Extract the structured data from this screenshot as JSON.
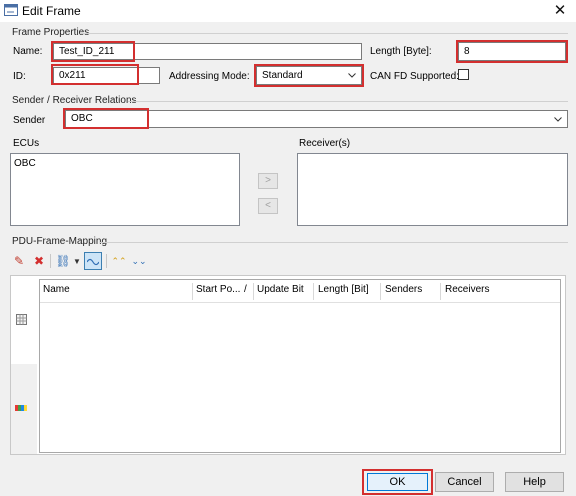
{
  "window": {
    "title": "Edit Frame"
  },
  "frame_properties": {
    "group_title": "Frame Properties",
    "name_label": "Name:",
    "name_value": "Test_ID_211",
    "length_label": "Length [Byte]:",
    "length_value": "8",
    "id_label": "ID:",
    "id_value": "0x211",
    "addressing_label": "Addressing Mode:",
    "addressing_value": "Standard",
    "canfd_label": "CAN FD Supported:"
  },
  "sender_receiver": {
    "group_title": "Sender / Receiver Relations",
    "sender_label": "Sender",
    "sender_value": "OBC",
    "ecus_label": "ECUs",
    "ecus_items": [
      "OBC"
    ],
    "receivers_label": "Receiver(s)",
    "add_arrow": ">",
    "remove_arrow": "<"
  },
  "pdu_mapping": {
    "group_title": "PDU-Frame-Mapping",
    "columns": [
      "Name",
      "Start Po...",
      "/",
      "Update Bit",
      "Length [Bit]",
      "Senders",
      "Receivers"
    ]
  },
  "buttons": {
    "ok": "OK",
    "cancel": "Cancel",
    "help": "Help"
  },
  "colors": {
    "highlight": "#d32f2f",
    "ok_border": "#0078d7"
  }
}
